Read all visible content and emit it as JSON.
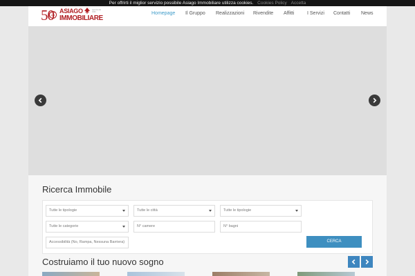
{
  "cookie": {
    "message": "Per offrirti il miglior servizio possibile Asiago Immobiliare utilizza cookies.",
    "policy_link": "Cookies Policy",
    "accept_link": "Accetta"
  },
  "brand": {
    "logo_number": "50",
    "logo_seal": "1964 2014",
    "logo_line1": "ASIAGO",
    "logo_line2": "IMMOBILIARE",
    "logo_tagline": "agenzia dal 1964",
    "color": "#b01e23"
  },
  "nav": {
    "items": [
      {
        "label": "Homepage",
        "active": true
      },
      {
        "label": "Il Gruppo",
        "active": false
      },
      {
        "label": "Realizzazioni",
        "active": false
      },
      {
        "label": "Rivendite",
        "active": false
      },
      {
        "label": "Affitti",
        "active": false
      },
      {
        "label": "I Servizi",
        "active": false
      },
      {
        "label": "Contatti",
        "active": false
      },
      {
        "label": "News",
        "active": false
      }
    ],
    "active_color": "#3e9bc9"
  },
  "slider": {
    "prev_icon": "chevron-left-icon",
    "next_icon": "chevron-right-icon"
  },
  "search": {
    "title": "Ricerca Immobile",
    "tipologie": "Tutte le tipologie",
    "citta": "Tutte le città",
    "tipologie2": "Tutte le tipologie",
    "categorie": "Tutte le categorie",
    "camere_placeholder": "N° camere",
    "bagni_placeholder": "N° bagni",
    "accessibilita_placeholder": "Accessibilità (No, Rampa, Nessuna Barriera)",
    "button_label": "CERCA",
    "button_color": "#3e8fc0"
  },
  "featured": {
    "title": "Costruiamo il tuo nuovo sogno",
    "prev_icon": "chevron-left-icon",
    "next_icon": "chevron-right-icon"
  }
}
